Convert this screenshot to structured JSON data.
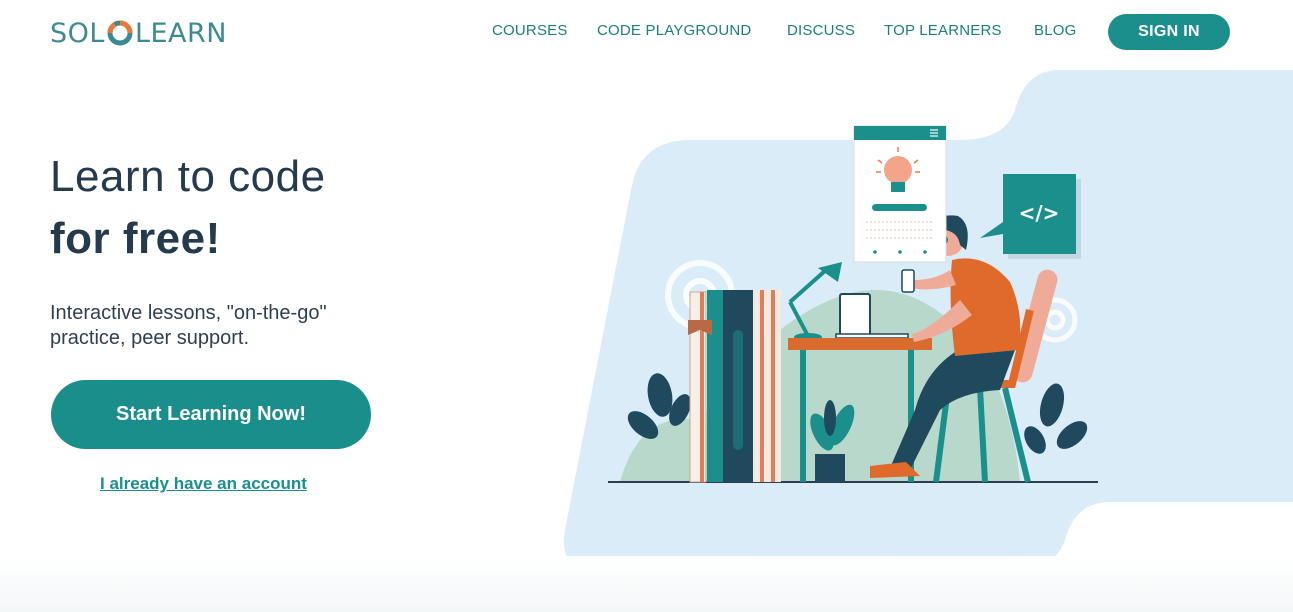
{
  "brand": {
    "logo_left": "SOL",
    "logo_right": "LEARN"
  },
  "nav": {
    "items": [
      "COURSES",
      "CODE PLAYGROUND",
      "DISCUSS",
      "TOP LEARNERS",
      "BLOG"
    ],
    "signin_label": "SIGN IN"
  },
  "hero": {
    "title_line1": "Learn to code",
    "title_line2": "for free!",
    "subtitle": "Interactive lessons, \"on-the-go\" practice, peer support.",
    "cta_label": "Start Learning Now!",
    "account_link": "I already have an account"
  },
  "illustration": {
    "code_symbol": "</>"
  },
  "colors": {
    "teal": "#1b8f8c",
    "dark_text": "#253a4c",
    "blob": "#d9ecf8",
    "orange": "#e06a2b"
  },
  "icons": [
    "lightbulb-icon",
    "code-icon",
    "gear-icon",
    "menu-icon"
  ]
}
